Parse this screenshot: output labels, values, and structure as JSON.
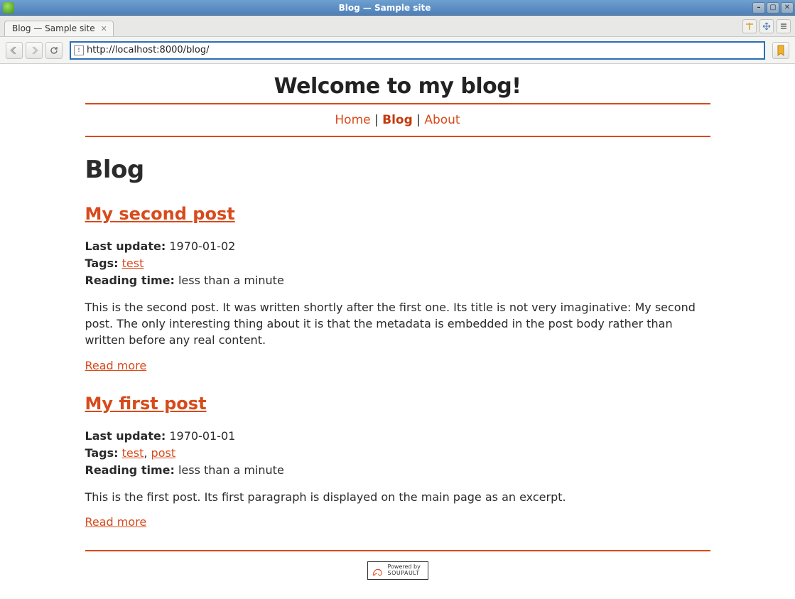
{
  "window": {
    "title": "Blog — Sample site"
  },
  "tab": {
    "label": "Blog — Sample site"
  },
  "url": "http://localhost:8000/blog/",
  "page": {
    "header_title": "Welcome to my blog!",
    "section_heading": "Blog",
    "nav": {
      "home": "Home",
      "blog": "Blog",
      "about": "About",
      "sep": " | "
    },
    "labels": {
      "last_update": "Last update:",
      "tags": "Tags:",
      "reading_time": "Reading time:",
      "read_more": "Read more"
    },
    "posts": [
      {
        "title": "My second post",
        "last_update": "1970-01-02",
        "tags": [
          "test"
        ],
        "reading_time": "less than a minute",
        "excerpt": "This is the second post. It was written shortly after the first one. Its title is not very imaginative: My second post. The only interesting thing about it is that the metadata is embedded in the post body rather than written before any real content."
      },
      {
        "title": "My first post",
        "last_update": "1970-01-01",
        "tags": [
          "test",
          "post"
        ],
        "reading_time": "less than a minute",
        "excerpt": "This is the first post. Its first paragraph is displayed on the main page as an excerpt."
      }
    ],
    "footer": {
      "line1": "Powered by",
      "line2": "SOUPAULT"
    }
  }
}
